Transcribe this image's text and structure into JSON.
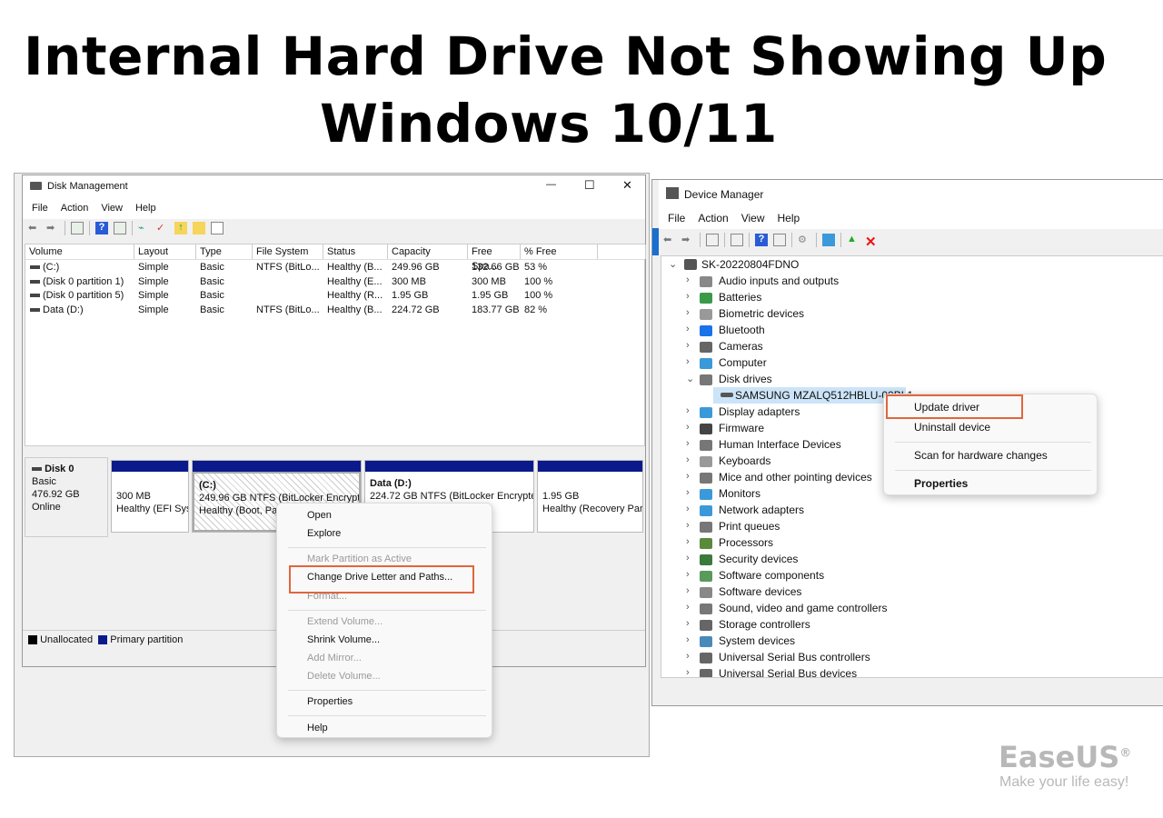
{
  "headline": {
    "line1": "Internal Hard Drive Not Showing Up",
    "line2": "Windows 10/11"
  },
  "disk_management": {
    "title": "Disk Management",
    "window_controls": {
      "minimize": "—",
      "maximize": "☐",
      "close": "✕"
    },
    "menu": [
      "File",
      "Action",
      "View",
      "Help"
    ],
    "columns": [
      "Volume",
      "Layout",
      "Type",
      "File System",
      "Status",
      "Capacity",
      "Free Spa...",
      "% Free"
    ],
    "rows": [
      [
        "(C:)",
        "Simple",
        "Basic",
        "NTFS (BitLo...",
        "Healthy (B...",
        "249.96 GB",
        "132.66 GB",
        "53 %"
      ],
      [
        "(Disk 0 partition 1)",
        "Simple",
        "Basic",
        "",
        "Healthy (E...",
        "300 MB",
        "300 MB",
        "100 %"
      ],
      [
        "(Disk 0 partition 5)",
        "Simple",
        "Basic",
        "",
        "Healthy (R...",
        "1.95 GB",
        "1.95 GB",
        "100 %"
      ],
      [
        "Data (D:)",
        "Simple",
        "Basic",
        "NTFS (BitLo...",
        "Healthy (B...",
        "224.72 GB",
        "183.77 GB",
        "82 %"
      ]
    ],
    "disk": {
      "name": "Disk 0",
      "type": "Basic",
      "size": "476.92 GB",
      "status": "Online"
    },
    "partitions": [
      {
        "name": "",
        "line1": "300 MB",
        "line2": "Healthy (EFI Sys"
      },
      {
        "name": "(C:)",
        "line1": "249.96 GB NTFS (BitLocker Encrypted",
        "line2": "Healthy (Boot, Page"
      },
      {
        "name": "Data  (D:)",
        "line1": "224.72 GB NTFS (BitLocker Encryptec",
        "line2": ")"
      },
      {
        "name": "",
        "line1": "1.95 GB",
        "line2": "Healthy (Recovery Par"
      }
    ],
    "legend": {
      "unallocated": "Unallocated",
      "primary": "Primary partition"
    },
    "context_menu": [
      {
        "label": "Open",
        "enabled": true
      },
      {
        "label": "Explore",
        "enabled": true
      },
      {
        "label": "Mark Partition as Active",
        "enabled": false
      },
      {
        "label": "Change Drive Letter and Paths...",
        "enabled": true,
        "highlighted": true
      },
      {
        "label": "Format...",
        "enabled": false
      },
      {
        "label": "Extend Volume...",
        "enabled": false
      },
      {
        "label": "Shrink Volume...",
        "enabled": true
      },
      {
        "label": "Add Mirror...",
        "enabled": false
      },
      {
        "label": "Delete Volume...",
        "enabled": false
      },
      {
        "label": "Properties",
        "enabled": true
      },
      {
        "label": "Help",
        "enabled": true
      }
    ]
  },
  "device_manager": {
    "title": "Device Manager",
    "menu": [
      "File",
      "Action",
      "View",
      "Help"
    ],
    "root": "SK-20220804FDNO",
    "categories": [
      "Audio inputs and outputs",
      "Batteries",
      "Biometric devices",
      "Bluetooth",
      "Cameras",
      "Computer",
      "Disk drives",
      "Display adapters",
      "Firmware",
      "Human Interface Devices",
      "Keyboards",
      "Mice and other pointing devices",
      "Monitors",
      "Network adapters",
      "Print queues",
      "Processors",
      "Security devices",
      "Software components",
      "Software devices",
      "Sound, video and game controllers",
      "Storage controllers",
      "System devices",
      "Universal Serial Bus controllers",
      "Universal Serial Bus devices"
    ],
    "selected_device": "SAMSUNG MZALQ512HBLU-00BL1",
    "context_menu": [
      "Update driver",
      "Uninstall device",
      "Scan for hardware changes",
      "Properties"
    ]
  },
  "brand": {
    "name": "EaseUS",
    "registered": "®",
    "tagline": "Make your life easy!"
  },
  "colors": {
    "highlight": "#e0663d",
    "partition_bar": "#0a1a8a",
    "selection": "#cce4f7"
  }
}
